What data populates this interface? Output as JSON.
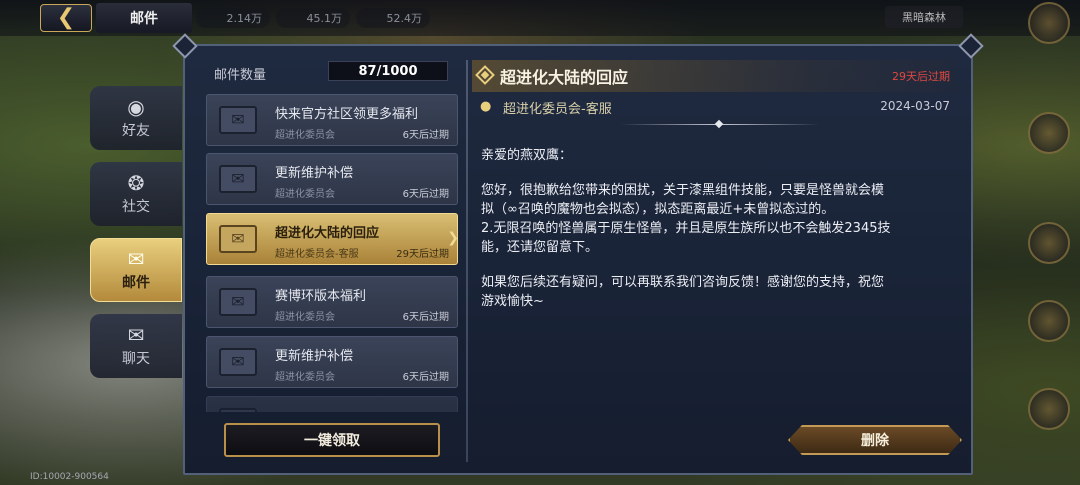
{
  "top": {
    "title": "邮件",
    "resources": [
      "2.14万",
      "45.1万",
      "52.4万"
    ],
    "region": "黑暗森林"
  },
  "tabs": [
    {
      "label": "好友",
      "icon": "pin-icon"
    },
    {
      "label": "社交",
      "icon": "network-icon"
    },
    {
      "label": "邮件",
      "icon": "envelope-icon",
      "active": true
    },
    {
      "label": "聊天",
      "icon": "chat-bubble-icon"
    }
  ],
  "mail_list": {
    "count_label": "邮件数量",
    "count_value": "87/1000",
    "items": [
      {
        "title": "快来官方社区领更多福利",
        "sender": "超进化委员会",
        "expire": "6天后过期"
      },
      {
        "title": "更新维护补偿",
        "sender": "超进化委员会",
        "expire": "6天后过期"
      },
      {
        "title": "超进化大陆的回应",
        "sender": "超进化委员会-客服",
        "expire": "29天后过期",
        "selected": true
      },
      {
        "title": "赛博环版本福利",
        "sender": "超进化委员会",
        "expire": "6天后过期"
      },
      {
        "title": "更新维护补偿",
        "sender": "超进化委员会",
        "expire": "6天后过期"
      }
    ],
    "collect_button": "一键领取"
  },
  "detail": {
    "title": "超进化大陆的回应",
    "expire": "29天后过期",
    "sender": "超进化委员会-客服",
    "date": "2024-03-07",
    "greeting": "亲爱的燕双鹰：",
    "paragraph1_line1": "您好，很抱歉给您带来的困扰，关于漆黑组件技能，只要是怪兽就会模",
    "paragraph1_line2": "拟（∞召唤的魔物也会拟态），拟态距离最近+未曾拟态过的。",
    "paragraph1_line3": "2.无限召唤的怪兽属于原生怪兽，并且是原生族所以也不会触发2345技",
    "paragraph1_line4": "能，还请您留意下。",
    "paragraph2_line1": "如果您后续还有疑问，可以再联系我们咨询反馈！感谢您的支持，祝您",
    "paragraph2_line2": "游戏愉快~",
    "delete_button": "删除"
  },
  "footer": {
    "id_text": "ID:10002-900564"
  }
}
